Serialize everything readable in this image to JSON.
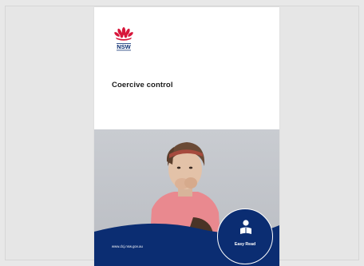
{
  "document": {
    "title": "Coercive control",
    "logo_text": "NSW",
    "footer_url": "www.dcj.nsw.gov.au",
    "badge_label": "Easy Read"
  },
  "colors": {
    "background": "#e8e8e8",
    "brand_navy": "#0b2d72",
    "brand_red": "#d7153a"
  },
  "icons": [
    "waratah-logo-icon",
    "reader-icon"
  ]
}
